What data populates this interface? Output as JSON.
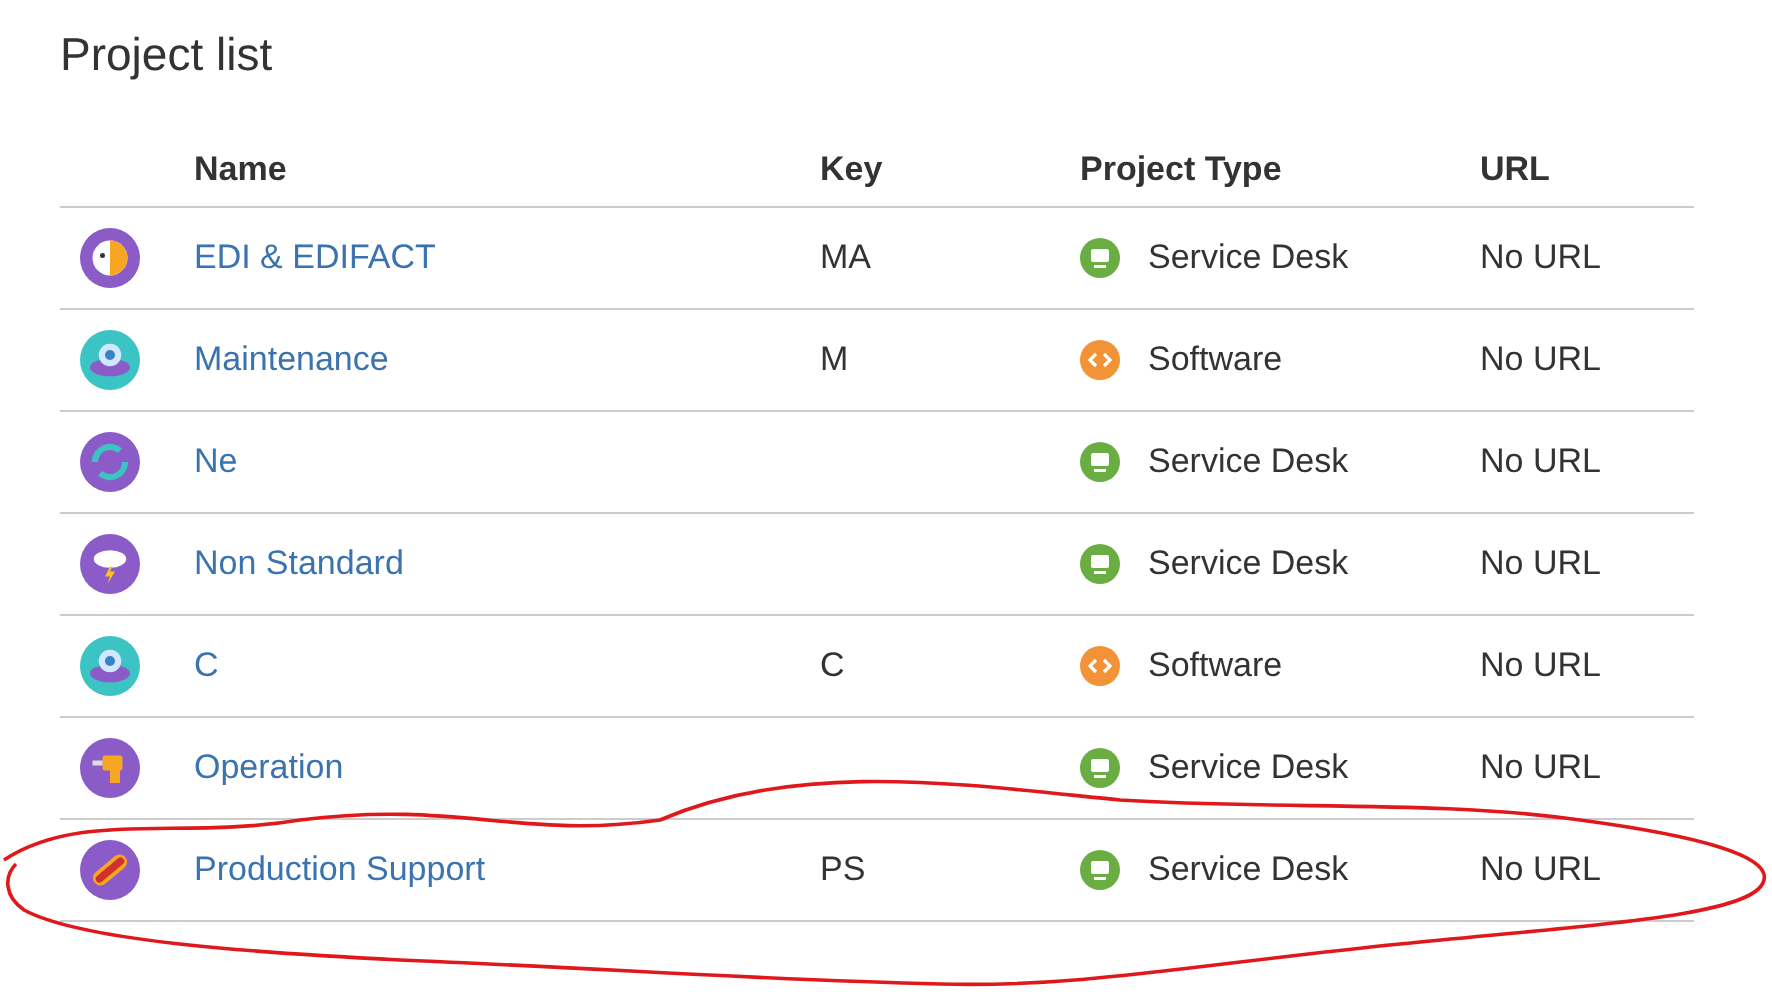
{
  "title": "Project list",
  "columns": [
    "Name",
    "Key",
    "Project Type",
    "URL"
  ],
  "rows": [
    {
      "kind": "parrot",
      "name": "EDI & EDIFACT",
      "key": "MA",
      "project_type": {
        "kind": "service",
        "label": "Service Desk"
      },
      "url": "No URL"
    },
    {
      "kind": "alien",
      "name": "Maintenance",
      "key": "M",
      "project_type": {
        "kind": "software",
        "label": "Software"
      },
      "url": "No URL"
    },
    {
      "kind": "sync",
      "name": "Ne",
      "project_type": {
        "kind": "service",
        "label": "Service Desk"
      },
      "url": "No URL"
    },
    {
      "kind": "storm",
      "name": "Non Standard",
      "project_type": {
        "kind": "service",
        "label": "Service Desk"
      },
      "url": "No URL"
    },
    {
      "kind": "alien",
      "name": "C",
      "key": "C",
      "project_type": {
        "kind": "software",
        "label": "Software"
      },
      "url": "No URL"
    },
    {
      "kind": "drill",
      "name": "Operation",
      "project_type": {
        "kind": "service",
        "label": "Service Desk"
      },
      "url": "No URL"
    },
    {
      "kind": "hotdog",
      "name": "Production Support",
      "key": "PS",
      "project_type": {
        "kind": "service",
        "label": "Service Desk"
      },
      "url": "No URL"
    }
  ]
}
